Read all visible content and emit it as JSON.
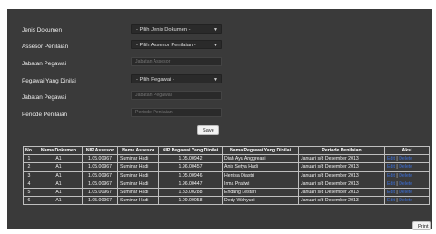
{
  "form": {
    "jenis_label": "Jenis Dokumen",
    "jenis_value": "- Pilih Jenis Dokumen -",
    "assesor_label": "Assesor Penilaian",
    "assesor_value": "- Pilih Assesor Penilaian -",
    "jabatan_assesor_label": "Jabatan Pegawai",
    "jabatan_assesor_placeholder": "Jabatan Assesor",
    "pegawai_label": "Pegawai Yang Dinilai",
    "pegawai_value": "- Pilih Pegawai -",
    "jabatan_pegawai_label": "Jabatan Pegawai",
    "jabatan_pegawai_placeholder": "Jabatan Pegawai",
    "periode_label": "Periode Penilaian",
    "periode_placeholder": "Periode Penilaian",
    "save_label": "Save"
  },
  "table": {
    "headers": [
      "No.",
      "Nama Dokumen",
      "NIP Assesor",
      "Nama Assesor",
      "NIP Pegawai Yang Dinilai",
      "Nama Pegawai Yang Dinilai",
      "Periode Penilaian",
      "Aksi"
    ],
    "rows": [
      {
        "no": "1",
        "dok": "A1",
        "nip_a": "1.05.00967",
        "nama_a": "Suminar Hadi",
        "nip_p": "1.05.00942",
        "nama_p": "Diah Ayu Anggreani",
        "periode": "Januari s/d Desember 2013",
        "edit": "Edit",
        "delete": "Delete"
      },
      {
        "no": "2",
        "dok": "A1",
        "nip_a": "1.05.00967",
        "nama_a": "Suminar Hadi",
        "nip_p": "1.96.00457",
        "nama_p": "Anis Setya Hadi",
        "periode": "Januari s/d Desember 2013",
        "edit": "Edit",
        "delete": "Delete"
      },
      {
        "no": "3",
        "dok": "A1",
        "nip_a": "1.05.00967",
        "nama_a": "Suminar Hadi",
        "nip_p": "1.05.00946",
        "nama_p": "Herrisa Diastri",
        "periode": "Januari s/d Desember 2013",
        "edit": "Edit",
        "delete": "Delete"
      },
      {
        "no": "4",
        "dok": "A1",
        "nip_a": "1.05.00967",
        "nama_a": "Suminar Hadi",
        "nip_p": "1.96.00447",
        "nama_p": "Irma Pratiwi",
        "periode": "Januari s/d Desember 2013",
        "edit": "Edit",
        "delete": "Delete"
      },
      {
        "no": "5",
        "dok": "A1",
        "nip_a": "1.05.00967",
        "nama_a": "Suminar Hadi",
        "nip_p": "1.83.00288",
        "nama_p": "Endang Lestari",
        "periode": "Januari s/d Desember 2013",
        "edit": "Edit",
        "delete": "Delete"
      },
      {
        "no": "6",
        "dok": "A1",
        "nip_a": "1.05.00967",
        "nama_a": "Suminar Hadi",
        "nip_p": "1.09.00058",
        "nama_p": "Dedy Wahyudi",
        "periode": "Januari s/d Desember 2013",
        "edit": "Edit",
        "delete": "Delete"
      }
    ]
  },
  "print_label": "Print",
  "colors": {
    "panel": "#3a3a3a",
    "link": "#3b6fd8"
  }
}
